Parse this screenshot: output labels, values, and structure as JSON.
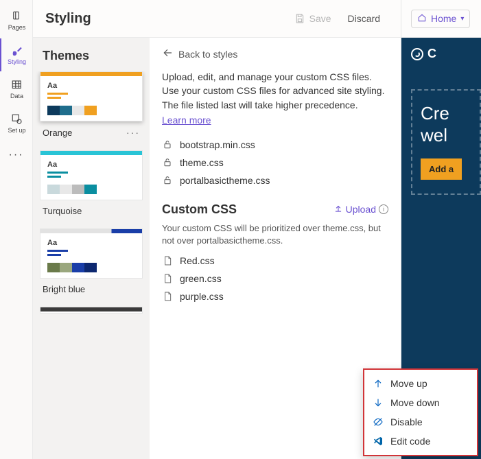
{
  "rail": {
    "items": [
      {
        "label": "Pages"
      },
      {
        "label": "Styling"
      },
      {
        "label": "Data"
      },
      {
        "label": "Set up"
      }
    ]
  },
  "header": {
    "title": "Styling",
    "save": "Save",
    "discard": "Discard"
  },
  "themes": {
    "heading": "Themes",
    "cards": [
      {
        "label": "Orange"
      },
      {
        "label": "Turquoise"
      },
      {
        "label": "Bright blue"
      }
    ]
  },
  "detail": {
    "back": "Back to styles",
    "description": "Upload, edit, and manage your custom CSS files. Use your custom CSS files for advanced site styling. The file listed last will take higher precedence.",
    "learn_more": "Learn more",
    "builtin_files": [
      "bootstrap.min.css",
      "theme.css",
      "portalbasictheme.css"
    ],
    "custom_heading": "Custom CSS",
    "upload_label": "Upload",
    "custom_note": "Your custom CSS will be prioritized over theme.css, but not over portalbasictheme.css.",
    "custom_files": [
      "Red.css",
      "green.css",
      "purple.css"
    ]
  },
  "preview": {
    "crumb": "Home",
    "brand_initial": "C",
    "hero_line1": "Cre",
    "hero_line2": "wel",
    "cta": "Add a"
  },
  "context_menu": {
    "items": [
      "Move up",
      "Move down",
      "Disable",
      "Edit code"
    ]
  }
}
